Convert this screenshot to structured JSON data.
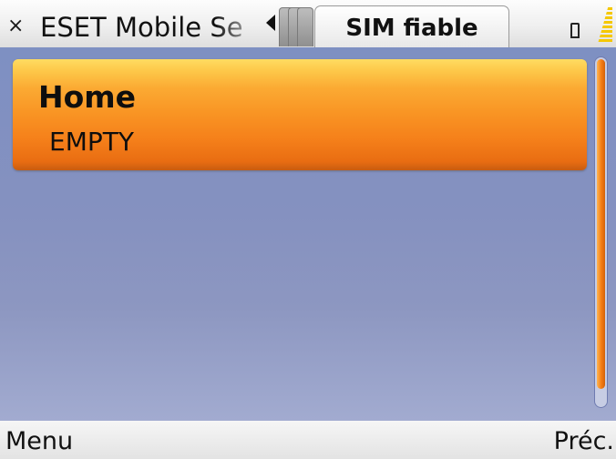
{
  "statusbar": {
    "close_glyph": "×",
    "app_title": "ESET Mobile Se",
    "prev_tab_icon": "triangle-left",
    "active_tab_label": "SIM fiable",
    "battery_icon": "battery",
    "signal_icon": "signal-strength"
  },
  "list": {
    "items": [
      {
        "title": "Home",
        "subtitle": "EMPTY",
        "selected": true
      }
    ]
  },
  "softkeys": {
    "left_label": "Menu",
    "right_label": "Préc."
  },
  "colors": {
    "content_background": "#8591c0",
    "highlight": "#f99524",
    "highlight_top": "#fedc62",
    "scrollbar_thumb": "#f47c13"
  }
}
